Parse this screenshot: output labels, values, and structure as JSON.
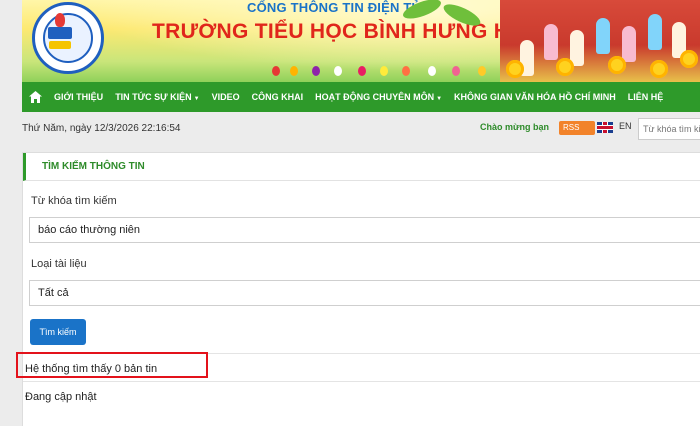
{
  "header": {
    "portal_title": "CỔNG THÔNG TIN ĐIỆN TỬ",
    "school_name": "TRƯỜNG TIỂU HỌC BÌNH HƯNG HÒA",
    "logo_icon": "school-logo"
  },
  "nav": {
    "home_icon": "home-icon",
    "items": [
      {
        "label": "GIỚI THIỆU",
        "has_dropdown": false
      },
      {
        "label": "TIN TỨC SỰ KIỆN",
        "has_dropdown": true
      },
      {
        "label": "VIDEO",
        "has_dropdown": false
      },
      {
        "label": "CÔNG KHAI",
        "has_dropdown": false
      },
      {
        "label": "HOẠT ĐỘNG CHUYÊN MÔN",
        "has_dropdown": true
      },
      {
        "label": "KHÔNG GIAN VĂN HÓA HỒ CHÍ MINH",
        "has_dropdown": false
      },
      {
        "label": "LIÊN HỆ",
        "has_dropdown": false
      }
    ],
    "color": "#2e9a2a"
  },
  "infobar": {
    "datetime": "Thứ Năm, ngày 12/3/2026 22:16:54",
    "welcome": "Chào mừng bạn",
    "rss": "RSS",
    "lang": "EN",
    "search_placeholder": "Từ khóa tìm kiếm"
  },
  "panel": {
    "title": "TÌM KIẾM THÔNG TIN",
    "keyword_label": "Từ khóa tìm kiếm",
    "keyword_value": "báo cáo thường niên",
    "doctype_label": "Loại tài liệu",
    "doctype_value": "Tất cả",
    "search_button": "Tìm kiếm",
    "result_text": "Hệ thống tìm thấy 0 bản tin",
    "status_text": "Đang cập nhật"
  },
  "colors": {
    "accent_green": "#2e9a2a",
    "button_blue": "#1a73c8",
    "highlight_red": "#e3121b",
    "school_red": "#e0261b"
  }
}
